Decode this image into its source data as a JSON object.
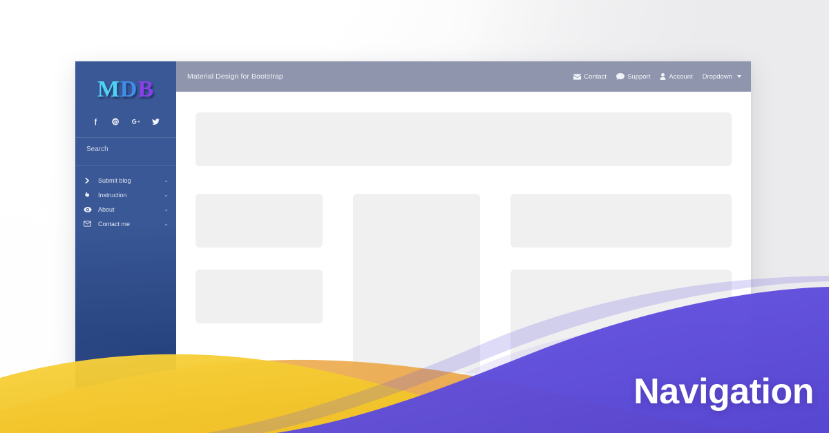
{
  "page": {
    "headline": "Navigation"
  },
  "colors": {
    "sidebar_top": "#3a5896",
    "sidebar_bottom": "#1e3a78",
    "navbar": "#8f95ad",
    "placeholder": "#f0f0f0",
    "wave_purple": "#5f4ddb",
    "wave_orange": "#e9a645",
    "wave_yellow": "#f4c92e",
    "logo_cyan": "#4fd3f5",
    "logo_blue": "#3f8fe8",
    "logo_purple": "#8a3fe8",
    "headline_text": "#ffffff"
  },
  "sidebar": {
    "logo": {
      "letter_1": "M",
      "letter_2": "D",
      "letter_3": "B"
    },
    "social": [
      {
        "name": "facebook-icon",
        "label": "Facebook"
      },
      {
        "name": "pinterest-icon",
        "label": "Pinterest"
      },
      {
        "name": "google-plus-icon",
        "label": "Google Plus"
      },
      {
        "name": "twitter-icon",
        "label": "Twitter"
      }
    ],
    "search": {
      "placeholder": "Search",
      "value": ""
    },
    "menu": [
      {
        "label": "Submit blog",
        "icon": "chevron-right-icon",
        "chevron": "⌄"
      },
      {
        "label": "Instruction",
        "icon": "hand-pointer-icon",
        "chevron": "⌄"
      },
      {
        "label": "About",
        "icon": "eye-icon",
        "chevron": "⌄"
      },
      {
        "label": "Contact me",
        "icon": "envelope-icon",
        "chevron": "⌄"
      }
    ]
  },
  "navbar": {
    "brand": "Material Design for Bootstrap",
    "links": [
      {
        "label": "Contact",
        "icon": "envelope-icon"
      },
      {
        "label": "Support",
        "icon": "comment-icon"
      },
      {
        "label": "Account",
        "icon": "user-icon"
      },
      {
        "label": "Dropdown",
        "icon": "caret-down-icon"
      }
    ]
  },
  "content": {
    "placeholders": [
      {
        "name": "hero-placeholder"
      },
      {
        "name": "left-placeholder-1"
      },
      {
        "name": "left-placeholder-2"
      },
      {
        "name": "middle-placeholder"
      },
      {
        "name": "right-placeholder-1"
      },
      {
        "name": "right-placeholder-2"
      }
    ]
  }
}
